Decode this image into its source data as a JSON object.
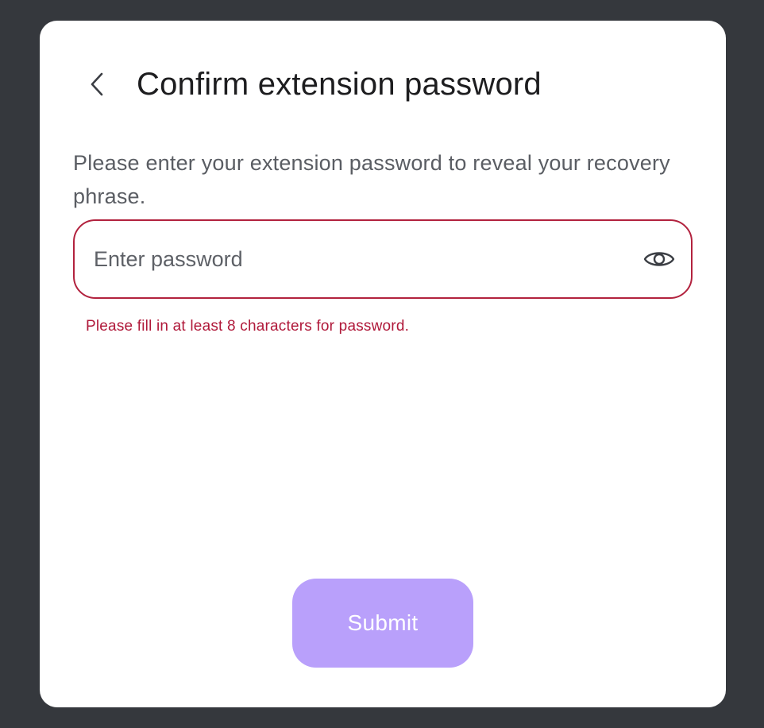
{
  "header": {
    "back_icon": "chevron-left-icon",
    "title": "Confirm extension password"
  },
  "form": {
    "description": "Please enter your extension password to reveal your recovery phrase.",
    "password": {
      "value": "",
      "placeholder": "Enter password",
      "visibility_icon": "eye-icon"
    },
    "error": "Please fill in at least 8 characters for password.",
    "submit_label": "Submit"
  },
  "colors": {
    "backdrop": "#35383d",
    "modal": "#ffffff",
    "error": "#b0193a",
    "submit_disabled": "#b9a0fb"
  }
}
